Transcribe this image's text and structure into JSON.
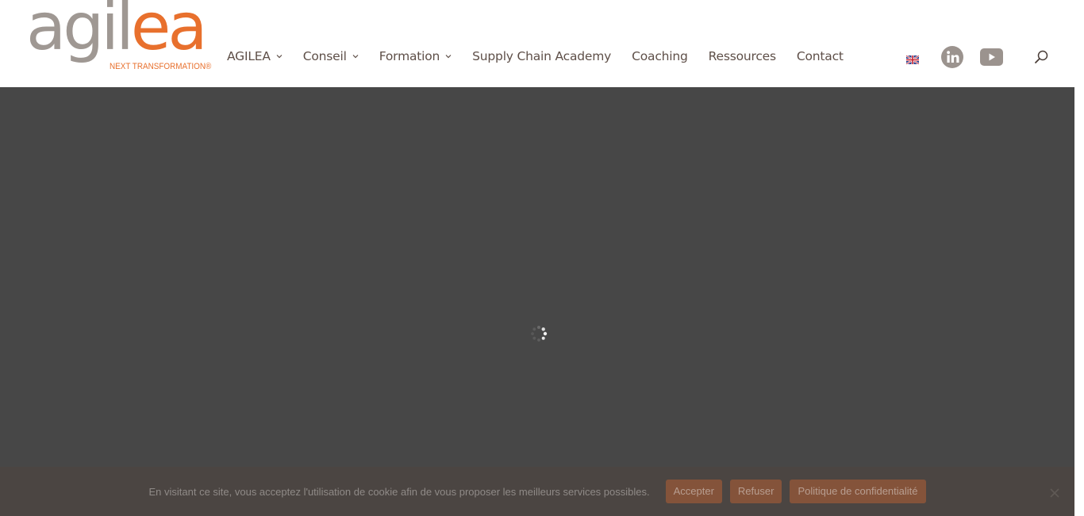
{
  "brand": {
    "logo_text_gray": "agil",
    "logo_text_orange": "ea",
    "tagline": "NEXT TRANSFORMATION®",
    "colors": {
      "gray": "#9f9893",
      "orange": "#e8702d"
    }
  },
  "nav": {
    "items": [
      {
        "label": "AGILEA",
        "has_dropdown": true
      },
      {
        "label": "Conseil",
        "has_dropdown": true
      },
      {
        "label": "Formation",
        "has_dropdown": true
      },
      {
        "label": "Supply Chain Academy",
        "has_dropdown": false
      },
      {
        "label": "Coaching",
        "has_dropdown": false
      },
      {
        "label": "Ressources",
        "has_dropdown": false
      },
      {
        "label": "Contact",
        "has_dropdown": false
      }
    ],
    "language_icon": "uk-flag-icon",
    "social": [
      "linkedin-icon",
      "youtube-icon"
    ],
    "search_icon": "search-icon"
  },
  "overlay": {
    "loading_icon": "spinner-icon",
    "color": "#474747"
  },
  "cookie_banner": {
    "message": "En visitant ce site, vous acceptez l'utilisation de cookie afin de vous proposer les meilleurs services possibles.",
    "accept_label": "Accepter",
    "refuse_label": "Refuser",
    "policy_label": "Politique de confidentialité",
    "close_icon": "close-icon",
    "button_color": "#84533a"
  }
}
